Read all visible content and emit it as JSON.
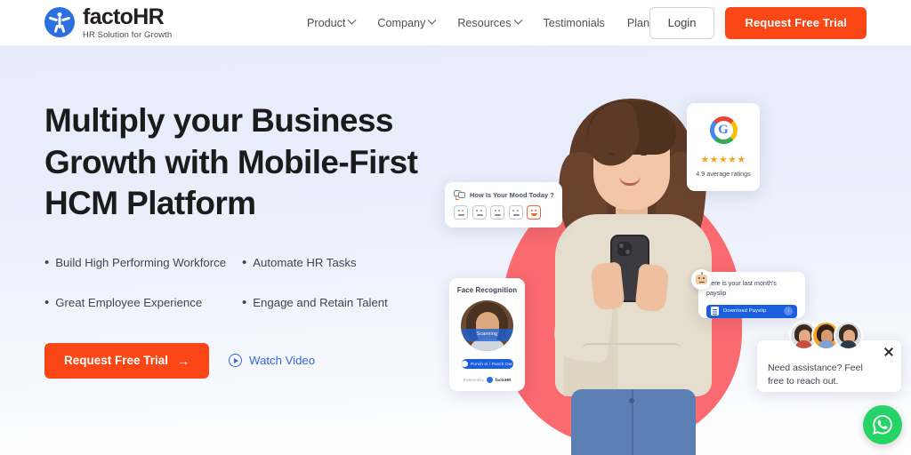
{
  "header": {
    "brand": {
      "name": "factoHR",
      "tagline": "HR Solution for Growth",
      "logo_icon": "person-logo-icon"
    },
    "nav": [
      {
        "label": "Product",
        "has_dropdown": true
      },
      {
        "label": "Company",
        "has_dropdown": true
      },
      {
        "label": "Resources",
        "has_dropdown": true
      },
      {
        "label": "Testimonials",
        "has_dropdown": false
      },
      {
        "label": "Plans",
        "has_dropdown": false
      }
    ],
    "login_label": "Login",
    "trial_label": "Request Free Trial"
  },
  "hero": {
    "headline": "Multiply your Business Growth with Mobile-First HCM Platform",
    "bullets": [
      "Build High Performing Workforce",
      "Automate HR Tasks",
      "Great Employee Experience",
      "Engage and Retain Talent"
    ],
    "cta_primary": "Request Free Trial",
    "cta_primary_arrow": "→",
    "cta_secondary": "Watch Video"
  },
  "cards": {
    "mood": {
      "title": "How Is Your Mood Today ?",
      "options": [
        "neutral",
        "sad",
        "neutral",
        "slight-smile",
        "happy"
      ],
      "selected_index": 4
    },
    "google": {
      "logo": "google-g-icon",
      "stars": "★★★★★",
      "rating_text": "4.9 average ratings"
    },
    "face_recognition": {
      "title": "Face Recognition",
      "scan_label": "Scanning",
      "button_label": "Punch In / Punch Out",
      "powered_by": "Powered by",
      "powered_brand": "factoHR"
    },
    "payslip": {
      "message": "Here is your last month's payslip",
      "button_label": "Download Payslip",
      "download_icon": "download-arrow-icon"
    }
  },
  "chat": {
    "message": "Need assistance? Feel free to reach out.",
    "close_icon": "close-icon",
    "whatsapp_icon": "whatsapp-icon"
  },
  "colors": {
    "brand_blue": "#2b6fe0",
    "accent_orange": "#fb4616",
    "coral": "#fa6a6e",
    "link_blue": "#2f6ae0",
    "whatsapp_green": "#25d366",
    "hero_bg_top": "#e7ecfb",
    "hero_bg_bottom": "#ffffff"
  }
}
